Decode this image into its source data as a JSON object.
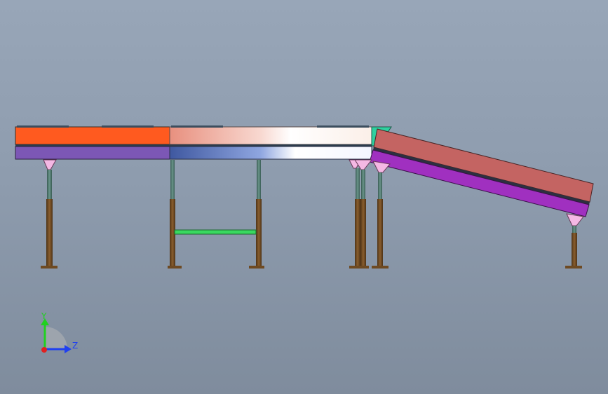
{
  "viewport": {
    "background_top": "#98a6b8",
    "background_bottom": "#7f8c9d"
  },
  "colors": {
    "conveyor_1_top": "#ff5a1f",
    "conveyor_1_bottom": "#7c57b5",
    "conveyor_2_top_start": "#e8907f",
    "conveyor_2_top_end": "#ffffff",
    "conveyor_2_bottom_start": "#4660a8",
    "conveyor_2_bottom_end": "#ffffff",
    "transfer_block": "#2fd0a0",
    "incline_top": "#c46462",
    "incline_bottom": "#a030c0",
    "leg_upper": "#4f7c72",
    "leg_lower": "#6e4a22",
    "crossbar": "#39d860",
    "bracket": "#f4b8e4",
    "axis_y": "#20d020",
    "axis_z": "#2040f0",
    "axis_x_dot": "#e02020"
  },
  "triad": {
    "y_label": "Y",
    "z_label": "Z"
  }
}
